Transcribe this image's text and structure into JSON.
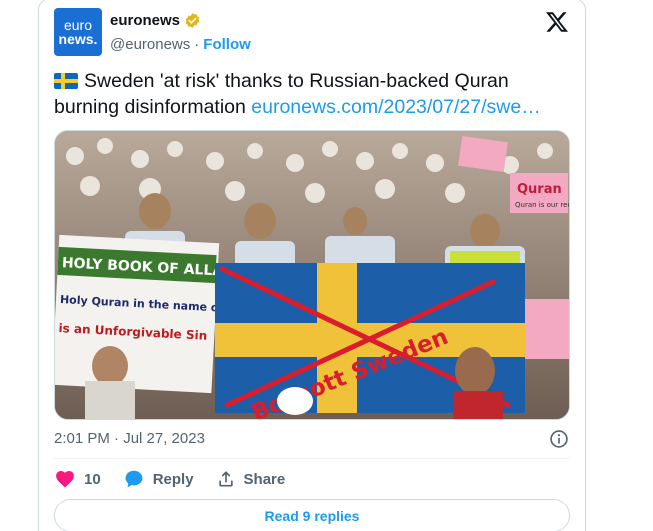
{
  "account": {
    "avatar_line1": "euro",
    "avatar_line2": "news.",
    "display_name": "euronews",
    "handle": "@euronews",
    "separator": "·",
    "follow_label": "Follow"
  },
  "tweet": {
    "text": "Sweden 'at risk' thanks to Russian-backed Quran burning disinformation ",
    "link_text": "euronews.com/2023/07/27/swe…",
    "timestamp": "2:01 PM · Jul 27, 2023"
  },
  "photo": {
    "banner_left_line1": "HOLY BOOK OF ALLAH",
    "banner_left_line2": "Holy Quran in the name of",
    "banner_left_line3": "is an Unforgivable Sin",
    "flag_text": "Boycott Sweden",
    "sign_right": "Quran is our red line",
    "sign_top": "Quran"
  },
  "actions": {
    "like_count": "10",
    "reply_label": "Reply",
    "share_label": "Share"
  },
  "replies_button": "Read 9 replies",
  "colors": {
    "accent": "#1d9bf0",
    "like": "#f91880",
    "avatar_bg": "#1a6fd4",
    "verified": "#e2b719"
  }
}
